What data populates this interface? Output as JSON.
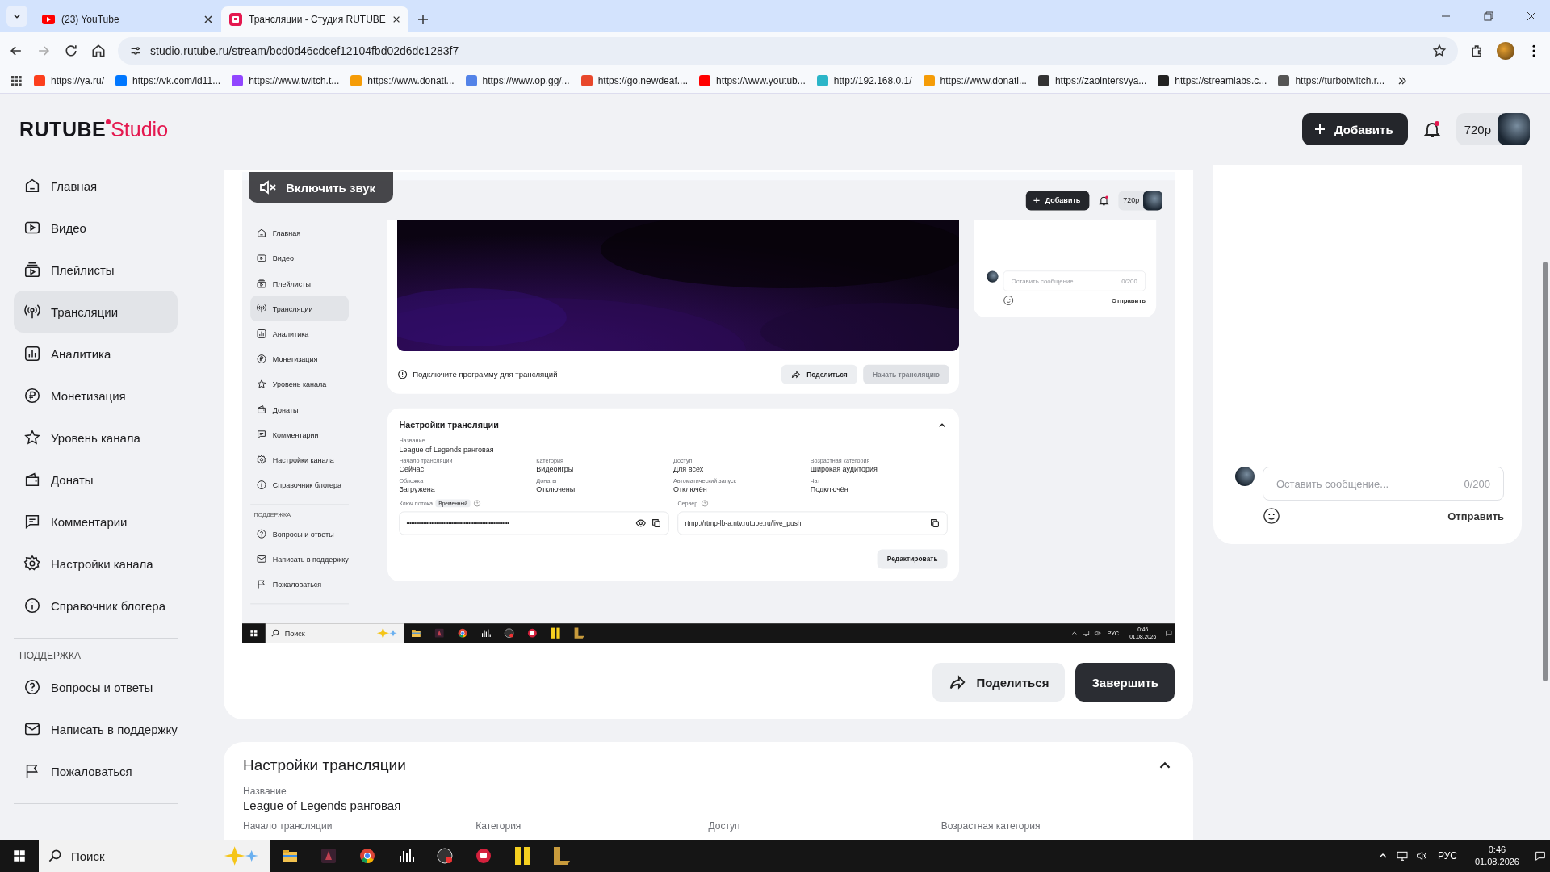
{
  "browser": {
    "tabs": [
      {
        "title": "(23) YouTube",
        "selected": false,
        "kind": "youtube"
      },
      {
        "title": "Трансляции - Студия RUTUBE",
        "selected": true,
        "kind": "rutube"
      }
    ],
    "url": "studio.rutube.ru/stream/bcd0d46cdcef12104fbd02d6dc1283f7",
    "bookmarks": [
      {
        "label": "https://ya.ru/",
        "color": "#fc3f1d"
      },
      {
        "label": "https://vk.com/id11...",
        "color": "#0077ff"
      },
      {
        "label": "https://www.twitch.t...",
        "color": "#9146ff"
      },
      {
        "label": "https://www.donati...",
        "color": "#f59c07"
      },
      {
        "label": "https://www.op.gg/...",
        "color": "#5383e8"
      },
      {
        "label": "https://go.newdeaf....",
        "color": "#e8472b"
      },
      {
        "label": "https://www.youtub...",
        "color": "#ff0000"
      },
      {
        "label": "http://192.168.0.1/",
        "color": "#2bb5c8"
      },
      {
        "label": "https://www.donati...",
        "color": "#f59c07"
      },
      {
        "label": "https://zaointersvya...",
        "color": "#333333"
      },
      {
        "label": "https://streamlabs.c...",
        "color": "#222222"
      },
      {
        "label": "https://turbotwitch.r...",
        "color": "#555555"
      }
    ]
  },
  "header": {
    "logo": "RUTUBE",
    "logo_suffix": "Studio",
    "add_button": "Добавить",
    "quality": "720p"
  },
  "sidebar": {
    "items": [
      {
        "label": "Главная",
        "selected": false
      },
      {
        "label": "Видео",
        "selected": false
      },
      {
        "label": "Плейлисты",
        "selected": false
      },
      {
        "label": "Трансляции",
        "selected": true
      },
      {
        "label": "Аналитика",
        "selected": false
      },
      {
        "label": "Монетизация",
        "selected": false
      },
      {
        "label": "Уровень канала",
        "selected": false
      },
      {
        "label": "Донаты",
        "selected": false
      },
      {
        "label": "Комментарии",
        "selected": false
      },
      {
        "label": "Настройки канала",
        "selected": false
      },
      {
        "label": "Справочник блогера",
        "selected": false
      }
    ],
    "section": "ПОДДЕРЖКА",
    "support_items": [
      {
        "label": "Вопросы и ответы"
      },
      {
        "label": "Написать в поддержку"
      },
      {
        "label": "Пожаловаться"
      }
    ]
  },
  "player": {
    "mute_button": "Включить звук"
  },
  "preview": {
    "add_button": "Добавить",
    "quality": "720p",
    "sidebar": {
      "items": [
        {
          "label": "Главная",
          "selected": false
        },
        {
          "label": "Видео",
          "selected": false
        },
        {
          "label": "Плейлисты",
          "selected": false
        },
        {
          "label": "Трансляции",
          "selected": true
        },
        {
          "label": "Аналитика",
          "selected": false
        },
        {
          "label": "Монетизация",
          "selected": false
        },
        {
          "label": "Уровень канала",
          "selected": false
        },
        {
          "label": "Донаты",
          "selected": false
        },
        {
          "label": "Комментарии",
          "selected": false
        },
        {
          "label": "Настройки канала",
          "selected": false
        },
        {
          "label": "Справочник блогера",
          "selected": false
        }
      ],
      "section": "ПОДДЕРЖКА",
      "support_items": [
        {
          "label": "Вопросы и ответы"
        },
        {
          "label": "Написать в поддержку"
        },
        {
          "label": "Пожаловаться"
        }
      ]
    },
    "notice": "Подключите программу для трансляций",
    "share": "Поделиться",
    "start": {
      "label": "Начать трансляцию",
      "disabled": true
    },
    "settings": {
      "title": "Настройки трансляции",
      "name_label": "Название",
      "name_value": "League of Legends ранговая",
      "fields": [
        {
          "label": "Начало трансляции",
          "value": "Сейчас"
        },
        {
          "label": "Категория",
          "value": "Видеоигры"
        },
        {
          "label": "Доступ",
          "value": "Для всех"
        },
        {
          "label": "Возрастная категория",
          "value": "Широкая аудитория"
        },
        {
          "label": "Обложка",
          "value": "Загружена"
        },
        {
          "label": "Донаты",
          "value": "Отключены"
        },
        {
          "label": "Автоматический запуск",
          "value": "Отключён"
        },
        {
          "label": "Чат",
          "value": "Подключён"
        }
      ],
      "key_label": "Ключ потока",
      "key_badge": "Временный",
      "key_value": "••••••••••••••••••••••••••••••••••••••••••••••••••••••••••••••••••",
      "server_label": "Сервер",
      "server_value": "rtmp://rtmp-lb-a.ntv.rutube.ru/live_push",
      "edit": "Редактировать"
    },
    "chat": {
      "placeholder": "Оставить сообщение...",
      "counter": "0/200",
      "send": "Отправить"
    },
    "taskbar": {
      "search": "Поиск",
      "lang": "РУС",
      "time": "0:46",
      "date": "01.08.2026"
    }
  },
  "actions": {
    "share": "Поделиться",
    "finish": "Завершить"
  },
  "settings": {
    "title": "Настройки трансляции",
    "name_label": "Название",
    "name_value": "League of Legends ранговая",
    "fields": [
      {
        "label": "Начало трансляции"
      },
      {
        "label": "Категория"
      },
      {
        "label": "Доступ"
      },
      {
        "label": "Возрастная категория"
      }
    ]
  },
  "chat": {
    "placeholder": "Оставить сообщение...",
    "counter": "0/200",
    "send": "Отправить"
  },
  "taskbar": {
    "search": "Поиск",
    "lang": "РУС",
    "time": "0:46",
    "date": "01.08.2026"
  }
}
